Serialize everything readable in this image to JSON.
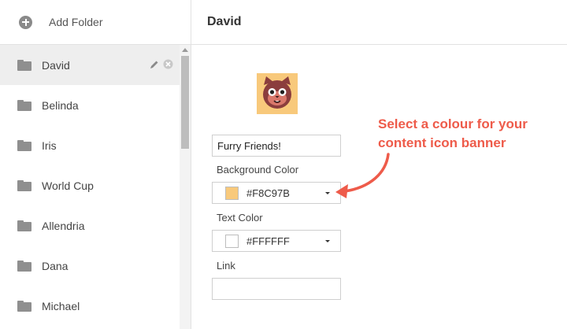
{
  "sidebar": {
    "add_folder_label": "Add Folder",
    "folders": [
      {
        "label": "David",
        "active": true
      },
      {
        "label": "Belinda"
      },
      {
        "label": "Iris"
      },
      {
        "label": "World Cup"
      },
      {
        "label": "Allendria"
      },
      {
        "label": "Dana"
      },
      {
        "label": "Michael"
      }
    ]
  },
  "main": {
    "title": "David",
    "avatar_icon": "cat-face-icon",
    "title_field_value": "Furry Friends!",
    "background_color_label": "Background Color",
    "background_color_value": "#F8C97B",
    "text_color_label": "Text Color",
    "text_color_value": "#FFFFFF",
    "link_label": "Link",
    "link_value": ""
  },
  "annotation": {
    "text_line1": "Select a colour for your",
    "text_line2": "content icon banner",
    "color": "#ee5b4a"
  }
}
